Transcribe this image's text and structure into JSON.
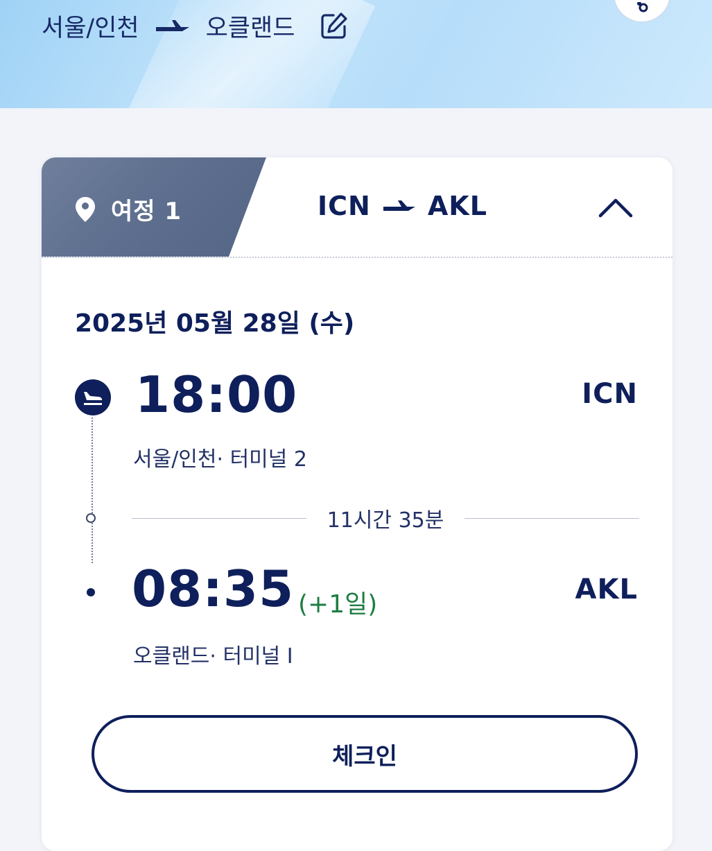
{
  "header": {
    "origin": "서울/인천",
    "destination": "오클랜드"
  },
  "card": {
    "tab_label": "여정 1",
    "route_from": "ICN",
    "route_to": "AKL",
    "date": "2025년 05월 28일 (수)",
    "departure": {
      "time": "18:00",
      "code": "ICN",
      "place": "서울/인천· 터미널  2"
    },
    "duration": "11시간 35분",
    "arrival": {
      "time": "08:35",
      "day_offset": "(+1일)",
      "code": "AKL",
      "place": "오클랜드· 터미널  I"
    },
    "checkin_label": "체크인"
  },
  "colors": {
    "navy": "#0e1f5b",
    "tab_gray": "#5d6e8e",
    "day_offset_green": "#1e7d42",
    "hero_sky": "#b6ddfa"
  },
  "icons": [
    "plane-right-icon",
    "edit-icon",
    "location-pin-icon",
    "chevron-up-icon",
    "departure-plane-icon"
  ]
}
